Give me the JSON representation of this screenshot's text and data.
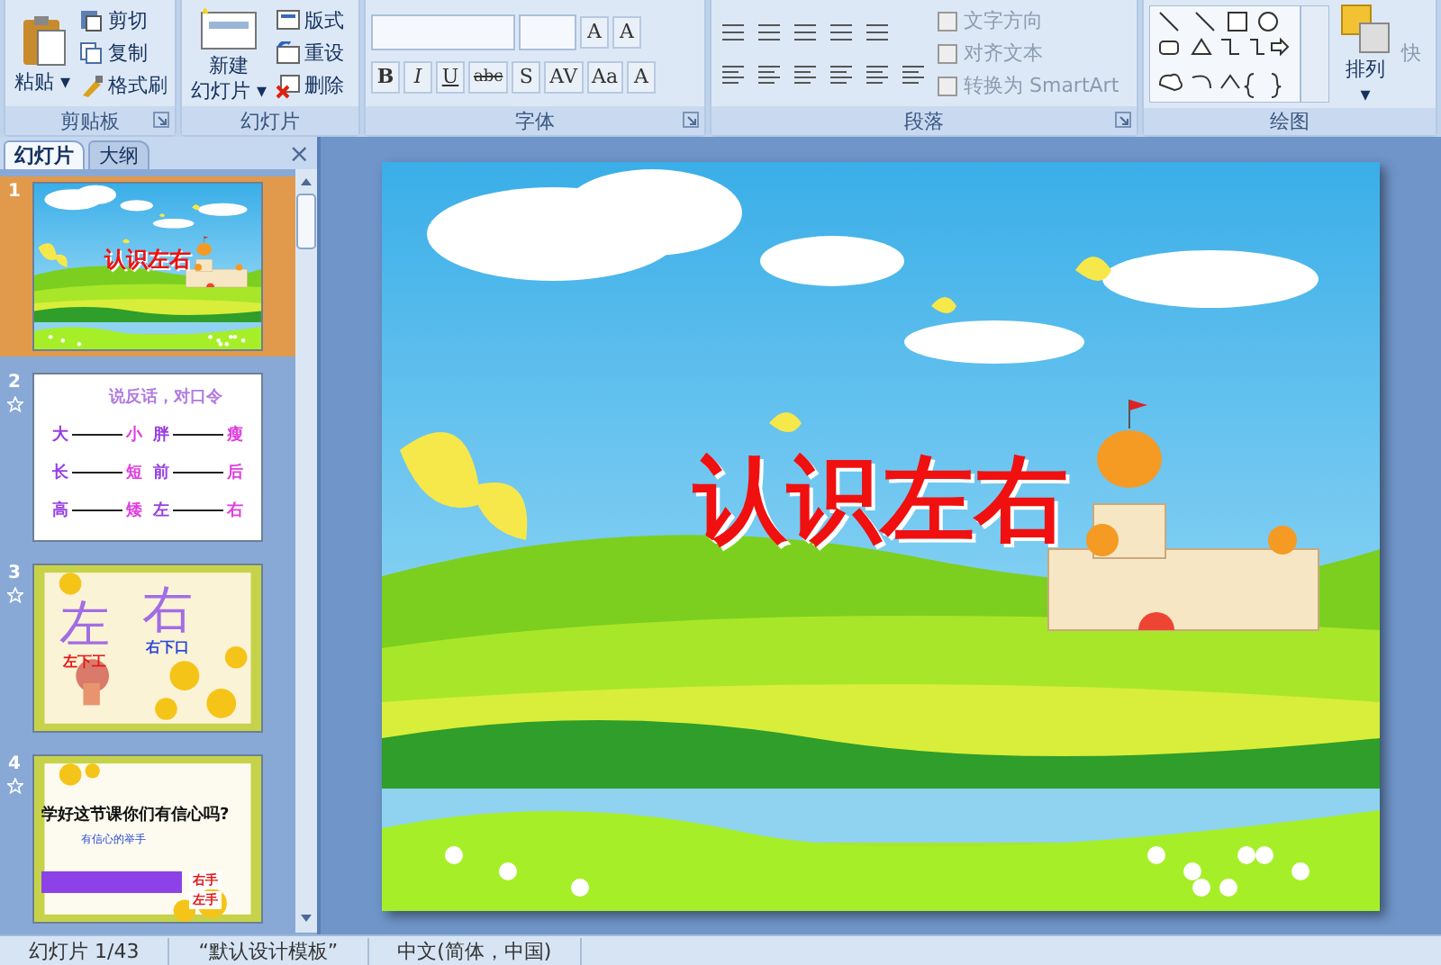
{
  "ribbon": {
    "groups": [
      {
        "kind": "clipboard",
        "label": "剪贴板",
        "big": {
          "lines": [
            "粘贴"
          ],
          "caret": "▾"
        },
        "items": [
          {
            "label": "剪切"
          },
          {
            "label": "复制"
          },
          {
            "label": "格式刷"
          }
        ],
        "launcher": true
      },
      {
        "kind": "slides",
        "label": "幻灯片",
        "big": {
          "lines": [
            "新建",
            "幻灯片"
          ],
          "caret": "▾"
        },
        "items": [
          {
            "label": "版式"
          },
          {
            "label": "重设"
          },
          {
            "label": "删除"
          }
        ],
        "launcher": false
      },
      {
        "kind": "font",
        "label": "字体",
        "top_buttons": [
          "A",
          "A"
        ],
        "format_buttons": [
          "B",
          "I",
          "U",
          "abc",
          "S",
          "AV",
          "Aa",
          "A"
        ],
        "launcher": true
      },
      {
        "kind": "paragraph",
        "label": "段落",
        "items": [
          {
            "label": "文字方向"
          },
          {
            "label": "对齐文本"
          },
          {
            "label": "转换为 SmartArt"
          }
        ],
        "launcher": true
      },
      {
        "kind": "drawing",
        "label": "绘图",
        "big": {
          "lines": [
            "排列"
          ],
          "caret": "▾"
        },
        "extra": "快",
        "launcher": false
      }
    ]
  },
  "pane": {
    "tabs": [
      {
        "label": "幻灯片",
        "selected": true
      },
      {
        "label": "大纲",
        "selected": false
      }
    ],
    "close": "×",
    "slides": [
      {
        "number": "1",
        "selected": true,
        "starred": false,
        "kind": "landscape",
        "title": "认识左右"
      },
      {
        "number": "2",
        "selected": false,
        "starred": true,
        "kind": "pairs",
        "title": "说反话，对口令",
        "pairs": [
          [
            "大",
            "小"
          ],
          [
            "胖",
            "瘦"
          ],
          [
            "长",
            "短"
          ],
          [
            "前",
            "后"
          ],
          [
            "高",
            "矮"
          ],
          [
            "左",
            "右"
          ]
        ]
      },
      {
        "number": "3",
        "selected": false,
        "starred": true,
        "kind": "characters",
        "chars": [
          "左",
          "右"
        ],
        "hints": [
          "左下工",
          "右下口"
        ]
      },
      {
        "number": "4",
        "selected": false,
        "starred": true,
        "kind": "question",
        "title": "学好这节课你们有信心吗?",
        "subtitle": "有信心的举手",
        "answers": [
          "右手",
          "左手"
        ]
      }
    ]
  },
  "slide": {
    "kind": "landscape",
    "title": "认识左右"
  },
  "status_bar": [
    "幻灯片 1/43",
    "“默认设计模板”",
    "中文(简体，中国)"
  ]
}
